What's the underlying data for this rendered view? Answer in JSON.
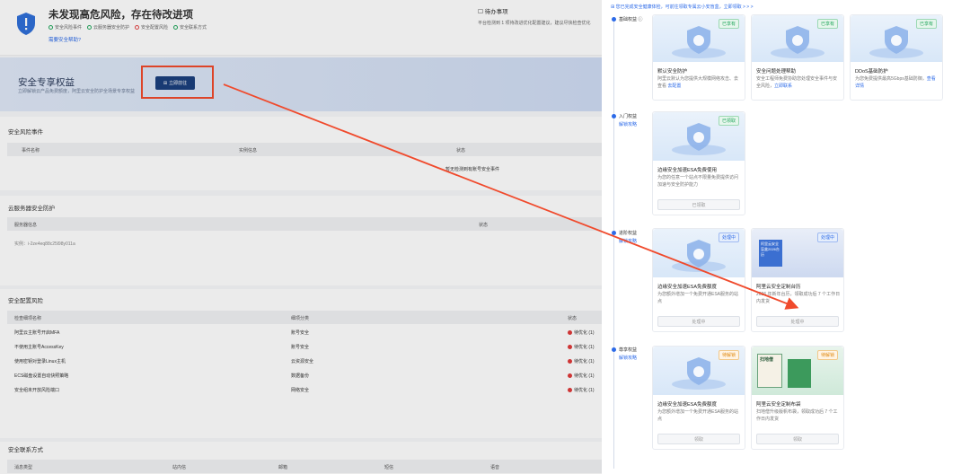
{
  "left": {
    "status_title": "未发现高危风险，存在待改进项",
    "stats": [
      {
        "label": "安全风险事件",
        "kind": "ok"
      },
      {
        "label": "云服务器安全防护",
        "kind": "ok"
      },
      {
        "label": "安全配置风险",
        "kind": "warn"
      },
      {
        "label": "安全联系方式",
        "kind": "ok"
      }
    ],
    "help_link": "需要安全帮助?",
    "todo_title": "待办事项",
    "todo_desc": "平台检测到 1 项待改进优化配置建议，建议尽快检查优化",
    "banner": {
      "title": "安全专享权益",
      "subtitle": "立即解锁云产品免费额度，阿里云安全防护全场景专享权益",
      "button": "立即前往"
    },
    "risk_events": {
      "title": "安全风险事件",
      "headers": [
        "事件名称",
        "实例信息",
        "状态"
      ],
      "empty": "暂无检测到有账号安全事件"
    },
    "server_protection": {
      "title": "云服务器安全防护",
      "headers": [
        "服务器信息",
        "状态"
      ],
      "row": "实例：i-2ze4eq88c25l98y011a"
    },
    "config_risk": {
      "title": "安全配置风险",
      "headers": [
        "检查细项名称",
        "细项分类",
        "状态"
      ],
      "rows": [
        {
          "name": "阿里云主账号开启MFA",
          "category": "账号安全",
          "status": "待优化 (1)"
        },
        {
          "name": "不使用主账号AccessKey",
          "category": "账号安全",
          "status": "待优化 (1)"
        },
        {
          "name": "使用密钥对登录Linux主机",
          "category": "云资源安全",
          "status": "待优化 (1)"
        },
        {
          "name": "ECS磁盘设置自动快照策略",
          "category": "数据备份",
          "status": "待优化 (1)"
        },
        {
          "name": "安全组未开放风险端口",
          "category": "网络安全",
          "status": "待优化 (1)"
        }
      ]
    },
    "contacts": {
      "title": "安全联系方式",
      "headers": [
        "消息类型",
        "站内信",
        "邮箱",
        "短信",
        "语音"
      ]
    }
  },
  "panel": {
    "notice": "您已完成安全健康体检，可前往领取专属云小安盲盒，立即领取 > > >",
    "tiers": [
      {
        "label": "基础权益",
        "sub": ""
      },
      {
        "label": "入门权益",
        "sub": "解锁攻略"
      },
      {
        "label": "进阶权益",
        "sub": "解锁攻略"
      },
      {
        "label": "尊享权益",
        "sub": "解锁攻略"
      }
    ],
    "cards": {
      "c1": {
        "tag": "已享有",
        "title": "默认安全防护",
        "desc": "阿里云默认为您提供大规模网络攻击、去查看",
        "link": "去查看",
        "link2": "去配置"
      },
      "c2": {
        "tag": "已享有",
        "title": "安全问题处理帮助",
        "desc": "安全工程师免费协助您处理安全事件与安全风险，",
        "link": "立即联系"
      },
      "c3": {
        "tag": "已享有",
        "title": "DDoS基础防护",
        "desc": "为您免费提供最高5Gbps基础防御，",
        "link": "查看详情"
      },
      "c4": {
        "tag": "已领取",
        "title": "边缘安全加速ESA免费使用",
        "desc": "为您的任意一个站点不限量免费提供访问加速与安全防护能力",
        "button": "已领取"
      },
      "c5": {
        "tag": "处理中",
        "title": "边缘安全加速ESA免费额度",
        "desc": "为您额外增加一个免费开通ESA服务的站点",
        "button": "处理中"
      },
      "c6": {
        "tag": "处理中",
        "title": "阿里云安全定制台历",
        "desc": "2026 年新年台历，领取成功后 7 个工作日内发货",
        "button": "处理中",
        "img_text": "阿里云安全盲盒2026台历"
      },
      "c7": {
        "tag": "待解锁",
        "title": "边缘安全加速ESA免费额度",
        "desc": "为您额外增加一个免费开通ESA服务的站点",
        "button": "领取"
      },
      "c8": {
        "tag": "待解锁",
        "title": "阿里云安全定制布袋",
        "desc": "扫地僧升级版帆布袋，领取成功后 7 个工作日内发货",
        "button": "领取",
        "img_text": "扫地僧"
      }
    }
  },
  "colors": {
    "accent": "#2c6ae8",
    "highlight": "#f04a2c",
    "navy": "#1b3f7d",
    "ok": "#21a65c",
    "danger": "#e03a3a"
  }
}
